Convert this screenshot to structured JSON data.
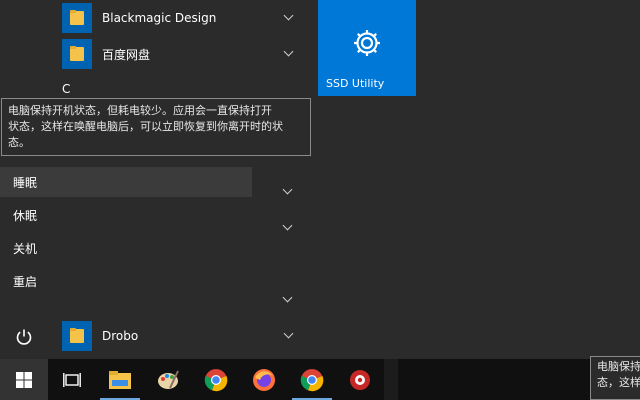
{
  "start_menu": {
    "apps": [
      {
        "label": "Blackmagic Design"
      },
      {
        "label": "百度网盘"
      },
      {
        "label": "Drobo"
      }
    ],
    "section_letter": "C",
    "tile": {
      "label": "SSD Utility",
      "icon": "gear-icon",
      "color": "#0078d7"
    }
  },
  "tooltip": {
    "line1": "电脑保持开机状态，但耗电较少。应用会一直保持打开",
    "line2": "状态，这样在唤醒电脑后，可以立即恢复到你离开时的状态。"
  },
  "power_menu": {
    "items": [
      {
        "label": "睡眠"
      },
      {
        "label": "休眠"
      },
      {
        "label": "关机"
      },
      {
        "label": "重启"
      }
    ]
  },
  "tray_tooltip": {
    "line1": "电脑保持",
    "line2": "态，这样"
  },
  "taskbar": {
    "icons": [
      "windows-logo-icon",
      "task-view-icon",
      "file-explorer-icon",
      "paint-icon",
      "chrome-icon",
      "firefox-icon",
      "chrome-canary-icon",
      "app-icon"
    ]
  }
}
